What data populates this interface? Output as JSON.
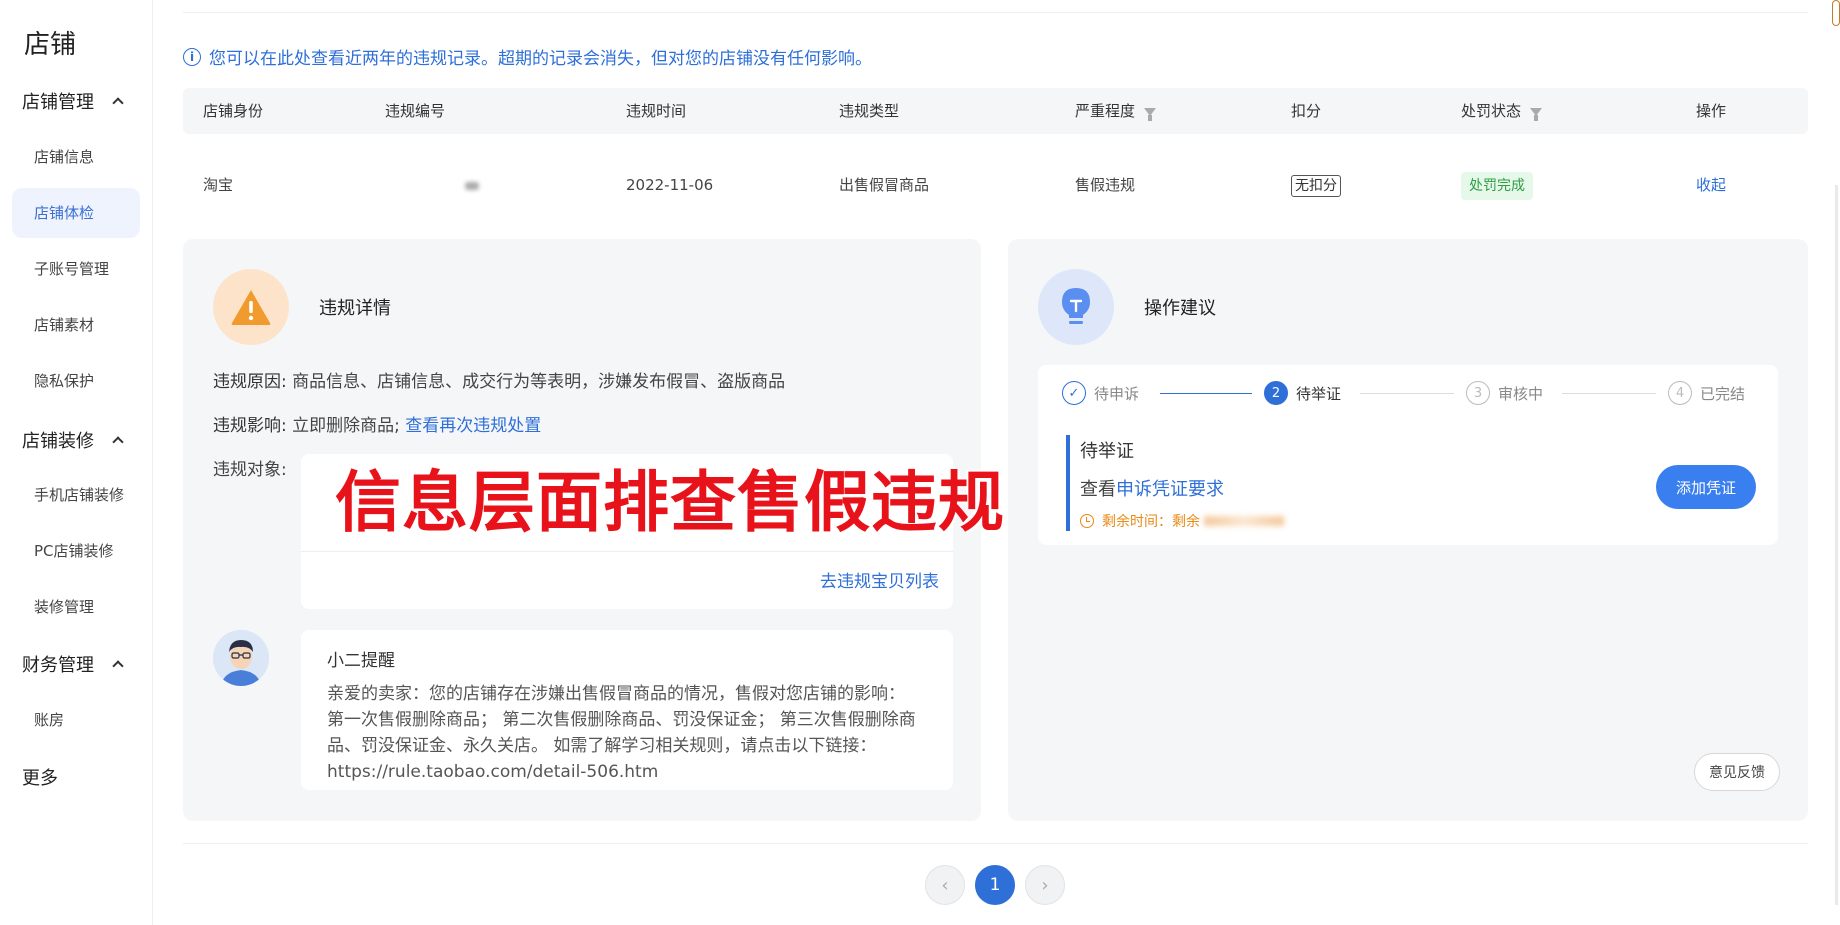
{
  "sidebar": {
    "title": "店铺",
    "groups": [
      {
        "label": "店铺管理",
        "items": [
          "店铺信息",
          "店铺体检",
          "子账号管理",
          "店铺素材",
          "隐私保护"
        ]
      },
      {
        "label": "店铺装修",
        "items": [
          "手机店铺装修",
          "PC店铺装修",
          "装修管理"
        ]
      },
      {
        "label": "财务管理",
        "items": [
          "账房"
        ]
      }
    ],
    "active_item": "店铺体检",
    "more": "更多"
  },
  "notice": "您可以在此处查看近两年的违规记录。超期的记录会消失，但对您的店铺没有任何影响。",
  "table": {
    "headers": [
      "店铺身份",
      "违规编号",
      "违规时间",
      "违规类型",
      "严重程度",
      "扣分",
      "处罚状态",
      "操作"
    ],
    "row": {
      "shop_identity": "淘宝",
      "violation_time": "2022-11-06",
      "violation_type": "出售假冒商品",
      "severity": "售假违规",
      "deduction": "无扣分",
      "status": "处罚完成",
      "action": "收起"
    }
  },
  "detail_panel": {
    "title": "违规详情",
    "reason_label": "违规原因:",
    "reason": "商品信息、店铺信息、成交行为等表明，涉嫌发布假冒、盗版商品",
    "impact_label": "违规影响:",
    "impact": "立即删除商品;",
    "impact_link": "查看再次违规处置",
    "object_label": "违规对象:",
    "object_link": "去违规宝贝列表",
    "overlay_text": "信息层面排查售假违规",
    "tip_title": "小二提醒",
    "tip_body": "亲爱的卖家：您的店铺存在涉嫌出售假冒商品的情况，售假对您店铺的影响： 第一次售假删除商品； 第二次售假删除商品、罚没保证金； 第三次售假删除商品、罚没保证金、永久关店。 如需了解学习相关规则，请点击以下链接：https://rule.taobao.com/detail-506.htm"
  },
  "advice_panel": {
    "title": "操作建议",
    "steps": [
      {
        "num": "✓",
        "label": "待申诉"
      },
      {
        "num": "2",
        "label": "待举证"
      },
      {
        "num": "3",
        "label": "审核中"
      },
      {
        "num": "4",
        "label": "已完结"
      }
    ],
    "evidence_title": "待举证",
    "evidence_prefix": "查看",
    "evidence_link": "申诉凭证要求",
    "remaining_time": "剩余时间：剩余",
    "add_button": "添加凭证",
    "feedback_button": "意见反馈"
  },
  "pagination": {
    "prev": "‹",
    "current": "1",
    "next": "›"
  },
  "colors": {
    "accent": "#2e6fd8",
    "warning": "#e88a14",
    "overlay": "#e8121b",
    "success": "#2f9e44"
  }
}
